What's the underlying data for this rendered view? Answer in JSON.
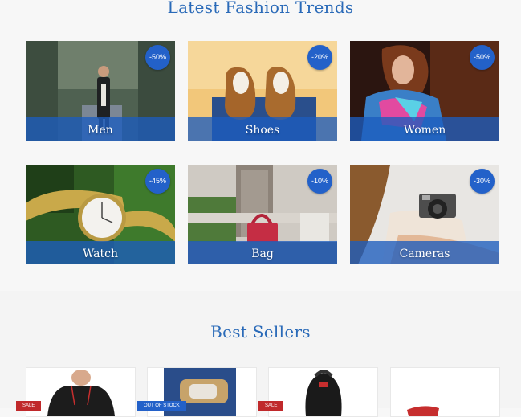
{
  "trends": {
    "title": "Latest Fashion Trends",
    "cards": [
      {
        "label": "Men",
        "discount": "-50%"
      },
      {
        "label": "Shoes",
        "discount": "-20%"
      },
      {
        "label": "Women",
        "discount": "-50%"
      },
      {
        "label": "Watch",
        "discount": "-45%"
      },
      {
        "label": "Bag",
        "discount": "-10%"
      },
      {
        "label": "Cameras",
        "discount": "-30%"
      }
    ]
  },
  "best_sellers": {
    "title": "Best Sellers",
    "products": [
      {
        "tag": "SALE"
      },
      {
        "tag": "OUT OF STOCK"
      },
      {
        "tag": "SALE"
      },
      {
        "tag": ""
      }
    ]
  },
  "colors": {
    "accent": "#2a6ab8",
    "badge": "#2361c9",
    "sale": "#c0292b"
  }
}
